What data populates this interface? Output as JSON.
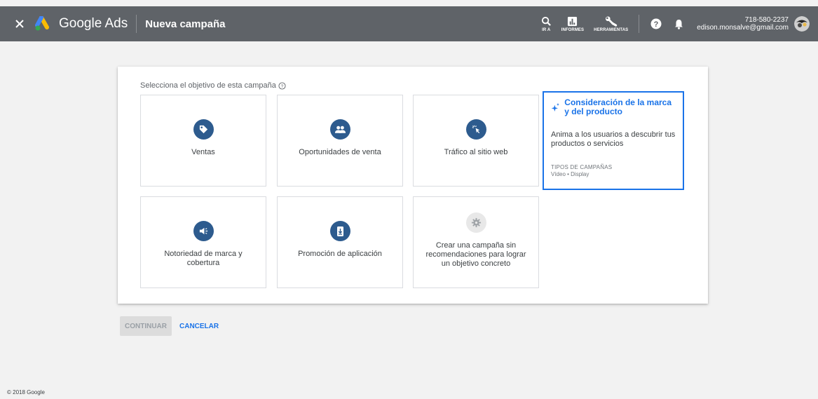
{
  "header": {
    "brand": "Google Ads",
    "page_title": "Nueva campaña",
    "tools": [
      {
        "label": "IR A",
        "icon": "search-icon"
      },
      {
        "label": "INFORMES",
        "icon": "reports-icon"
      },
      {
        "label": "HERRAMIENTAS",
        "icon": "wrench-icon"
      }
    ],
    "account": {
      "phone": "718-580-2237",
      "email": "edison.monsalve@gmail.com"
    }
  },
  "main": {
    "prompt": "Selecciona el objetivo de esta campaña",
    "goals": [
      {
        "label": "Ventas",
        "icon": "tag-icon"
      },
      {
        "label": "Oportunidades de venta",
        "icon": "people-icon"
      },
      {
        "label": "Tráfico al sitio web",
        "icon": "cursor-click-icon"
      },
      {
        "label": "Notoriedad de marca y cobertura",
        "icon": "megaphone-icon"
      },
      {
        "label": "Promoción de aplicación",
        "icon": "phone-download-icon"
      },
      {
        "label": "Crear una campaña sin recomendaciones para lograr un objetivo concreto",
        "icon": "gear-icon"
      }
    ],
    "selected": {
      "title": "Consideración de la marca y del producto",
      "description": "Anima a los usuarios a descubrir tus productos o servicios",
      "types_heading": "TIPOS DE CAMPAÑAS",
      "types": "Vídeo • Display",
      "icon": "sparkle-icon"
    }
  },
  "actions": {
    "continue": "CONTINUAR",
    "cancel": "CANCELAR"
  },
  "footer": {
    "copyright": "© 2018 Google"
  },
  "colors": {
    "accent": "#1a73e8",
    "icon_bg": "#2d5b8e",
    "topbar": "#5f6368"
  }
}
